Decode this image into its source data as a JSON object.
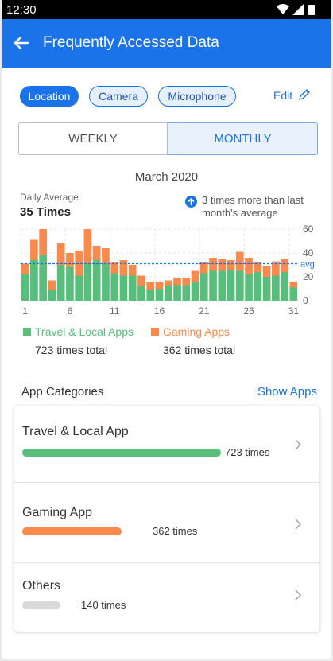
{
  "status_bar": {
    "time": "12:30",
    "icons": [
      "wifi-icon",
      "signal-icon",
      "battery-icon"
    ]
  },
  "app_bar": {
    "title": "Frequently Accessed Data",
    "back_icon": "arrow-left-icon"
  },
  "filters": {
    "chips": [
      "Location",
      "Camera",
      "Microphone"
    ],
    "selected": "Location",
    "edit_label": "Edit"
  },
  "period_tabs": {
    "weekly": "WEEKLY",
    "monthly": "MONTHLY",
    "selected": "MONTHLY"
  },
  "summary": {
    "period": "March 2020",
    "daily_average_label": "Daily Average",
    "daily_average_value": "35 Times",
    "comparison": "3 times more than last month's average"
  },
  "colors": {
    "primary": "#1a73e8",
    "travel": "#57be7c",
    "gaming": "#f78a4c",
    "others": "#d9d9d9"
  },
  "chart_data": {
    "type": "bar",
    "stacked": true,
    "x": [
      1,
      2,
      3,
      4,
      5,
      6,
      7,
      8,
      9,
      10,
      11,
      12,
      13,
      14,
      15,
      16,
      17,
      18,
      19,
      20,
      21,
      22,
      23,
      24,
      25,
      26,
      27,
      28,
      29,
      30,
      31
    ],
    "x_tick_labels": [
      "1",
      "6",
      "11",
      "16",
      "21",
      "26",
      "31"
    ],
    "y_tick_labels": [
      "60",
      "40",
      "20",
      "0"
    ],
    "ylim": [
      0,
      60
    ],
    "average_value": 31,
    "average_label": "avg",
    "grid": true,
    "series": [
      {
        "name": "Travel & Local Apps",
        "color": "#57be7c",
        "values": [
          22,
          34,
          38,
          9,
          30,
          28,
          21,
          31,
          34,
          31,
          23,
          21,
          21,
          12,
          9,
          10,
          13,
          13,
          13,
          16,
          23,
          25,
          25,
          26,
          25,
          22,
          24,
          20,
          21,
          24,
          11
        ]
      },
      {
        "name": "Gaming Apps",
        "color": "#f78a4c",
        "values": [
          9,
          17,
          22,
          8,
          18,
          12,
          21,
          29,
          12,
          13,
          9,
          13,
          9,
          9,
          7,
          6,
          4,
          6,
          6,
          9,
          9,
          11,
          10,
          8,
          16,
          14,
          8,
          9,
          12,
          11,
          5
        ]
      }
    ]
  },
  "legend": [
    {
      "label": "Travel & Local Apps",
      "total": "723 times total"
    },
    {
      "label": "Gaming Apps",
      "total": "362 times total"
    }
  ],
  "categories_section": {
    "title": "App Categories",
    "action": "Show Apps",
    "items": [
      {
        "name": "Travel & Local App",
        "count": "723 times",
        "value": 723
      },
      {
        "name": "Gaming App",
        "count": "362 times",
        "value": 362
      },
      {
        "name": "Others",
        "count": "140 times",
        "value": 140
      }
    ]
  }
}
